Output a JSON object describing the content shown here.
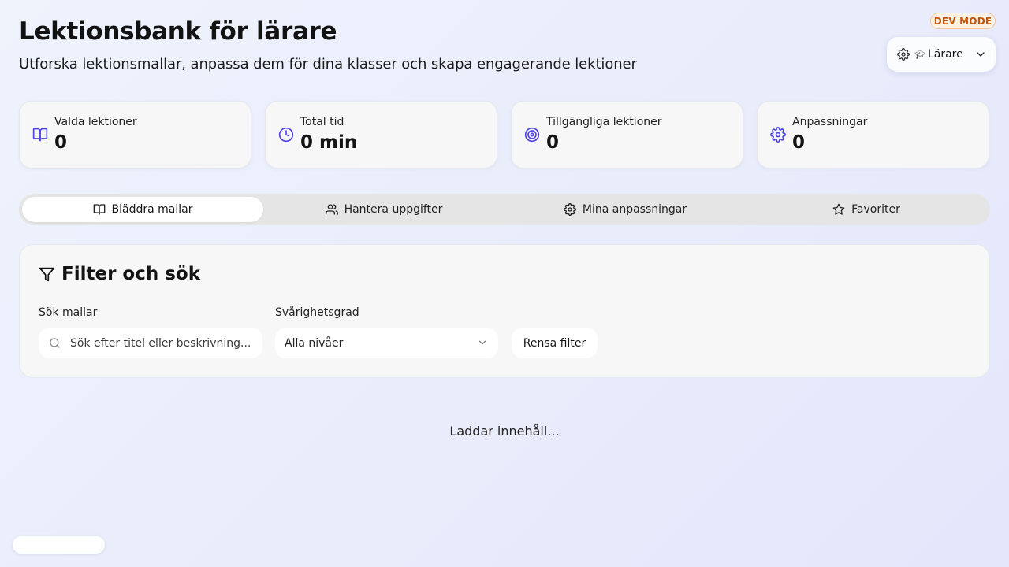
{
  "header": {
    "title": "Lektionsbank för lärare",
    "subtitle": "Utforska lektionsmallar, anpassa dem för dina klasser och skapa engagerande lektioner"
  },
  "dev_badge": "DEV MODE",
  "role_select": {
    "cap_glyph": "🎓︎",
    "label": "Lärare"
  },
  "stats": [
    {
      "icon": "book-open-icon",
      "label": "Valda lektioner",
      "value": "0"
    },
    {
      "icon": "clock-icon",
      "label": "Total tid",
      "value": "0 min"
    },
    {
      "icon": "target-icon",
      "label": "Tillgängliga lektioner",
      "value": "0"
    },
    {
      "icon": "gear-icon",
      "label": "Anpassningar",
      "value": "0"
    }
  ],
  "tabs": [
    {
      "icon": "book-open-icon",
      "label": "Bläddra mallar",
      "active": true
    },
    {
      "icon": "users-icon",
      "label": "Hantera uppgifter",
      "active": false
    },
    {
      "icon": "gear-icon",
      "label": "Mina anpassningar",
      "active": false
    },
    {
      "icon": "star-icon",
      "label": "Favoriter",
      "active": false
    }
  ],
  "filter": {
    "title": "Filter och sök",
    "search_label": "Sök mallar",
    "search_placeholder": "Sök efter titel eller beskrivning...",
    "search_value": "",
    "difficulty_label": "Svårighetsgrad",
    "difficulty_value": "Alla nivåer",
    "clear_label": "Rensa filter"
  },
  "loading_text": "Laddar innehåll...",
  "colors": {
    "accent": "#4f46e5",
    "badge_text": "#c2570c",
    "badge_bg": "#fdf1e4"
  }
}
